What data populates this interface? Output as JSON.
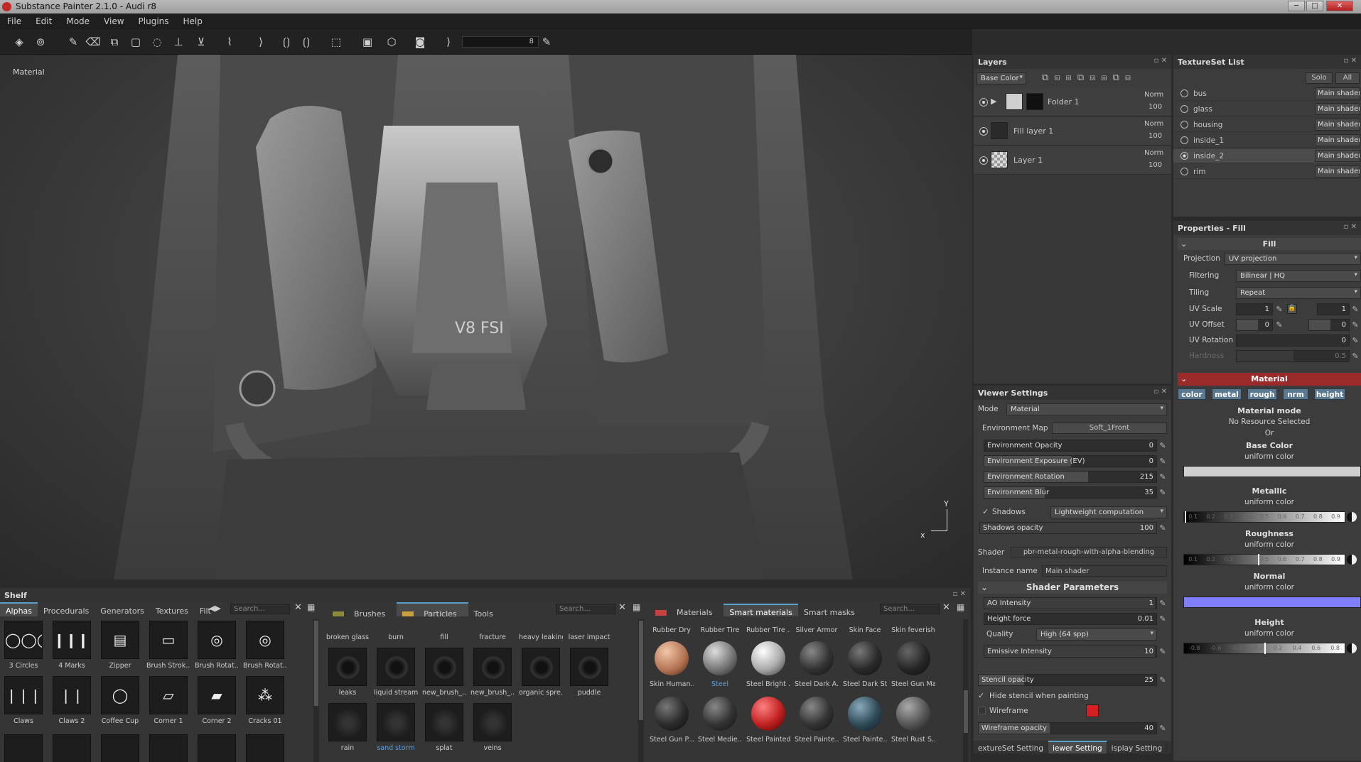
{
  "window": {
    "title": "Substance Painter 2.1.0 - Audi r8",
    "minimize": "─",
    "maximize": "□",
    "close": "✕"
  },
  "menu": [
    "File",
    "Edit",
    "Mode",
    "View",
    "Plugins",
    "Help"
  ],
  "toolbar": {
    "brush_size": "8",
    "icons": [
      "layers-icon",
      "substance-icon",
      "paint-brush-icon",
      "eraser-icon",
      "projection-icon",
      "polygon-fill-icon",
      "lasso-icon",
      "clone-icon",
      "stamp-icon",
      "smudge-icon",
      "picker-icon",
      "symmetry-icon",
      "camera-icon",
      "render-icon",
      "screenshot-icon"
    ]
  },
  "viewport": {
    "mode_label": "Material",
    "axis_x": "x",
    "axis_y": "Y",
    "engine_text": "V8 FSI"
  },
  "layers": {
    "title": "Layers",
    "channel": "Base Color",
    "items": [
      {
        "name": "Folder 1",
        "blend": "Norm",
        "opacity": "100"
      },
      {
        "name": "Fill layer 1",
        "blend": "Norm",
        "opacity": "100"
      },
      {
        "name": "Layer 1",
        "blend": "Norm",
        "opacity": "100"
      }
    ]
  },
  "textureset": {
    "title": "TextureSet List",
    "solo": "Solo",
    "all": "All",
    "items": [
      {
        "name": "bus",
        "shader": "Main shader"
      },
      {
        "name": "glass",
        "shader": "Main shader"
      },
      {
        "name": "housing",
        "shader": "Main shader"
      },
      {
        "name": "inside_1",
        "shader": "Main shader"
      },
      {
        "name": "inside_2",
        "shader": "Main shader"
      },
      {
        "name": "rim",
        "shader": "Main shader"
      }
    ]
  },
  "properties": {
    "title": "Properties - Fill",
    "fill_header": "Fill",
    "projection_label": "Projection",
    "projection_value": "UV projection",
    "filtering_label": "Filtering",
    "filtering_value": "Bilinear | HQ",
    "tiling_label": "Tiling",
    "tiling_value": "Repeat",
    "uv_scale_label": "UV Scale",
    "uv_scale_value": "1",
    "uv_scale_value2": "1",
    "uv_offset_label": "UV Offset",
    "uv_offset_value": "0",
    "uv_offset_value2": "0",
    "uv_rotation_label": "UV Rotation",
    "uv_rotation_value": "0",
    "hardness_label": "Hardness",
    "hardness_value": "0.5",
    "material_header": "Material",
    "channels": [
      "color",
      "metal",
      "rough",
      "nrm",
      "height"
    ],
    "material_mode_title": "Material mode",
    "material_mode_value": "No Resource Selected",
    "or_text": "Or",
    "base_color_title": "Base Color",
    "base_color_sub": "uniform color",
    "base_color_hex": "#cfcfcf",
    "metallic_title": "Metallic",
    "metallic_sub": "uniform color",
    "metallic_ticks": [
      "0.1",
      "0.2",
      "0.3",
      "0.4",
      "0.5",
      "0.6",
      "0.7",
      "0.8",
      "0.9"
    ],
    "roughness_title": "Roughness",
    "roughness_sub": "uniform color",
    "roughness_ticks": [
      "0.1",
      "0.2",
      "0.3",
      "0.4",
      "0.5",
      "0.6",
      "0.7",
      "0.8",
      "0.9"
    ],
    "normal_title": "Normal",
    "normal_sub": "uniform color",
    "normal_hex": "#7f7fff",
    "height_title": "Height",
    "height_sub": "uniform color",
    "height_ticks": [
      "-0.8",
      "-0.6",
      "-0.4",
      "-0.2",
      "0.2",
      "0.4",
      "0.6",
      "0.8"
    ]
  },
  "viewer": {
    "title": "Viewer Settings",
    "mode_label": "Mode",
    "mode_value": "Material",
    "env_map_label": "Environment Map",
    "env_map_value": "Soft_1Front",
    "env_opacity_label": "Environment Opacity",
    "env_opacity_value": "0",
    "env_exposure_label": "Environment Exposure (EV)",
    "env_exposure_value": "0",
    "env_rotation_label": "Environment Rotation",
    "env_rotation_value": "215",
    "env_blur_label": "Environment Blur",
    "env_blur_value": "35",
    "shadows_label": "Shadows",
    "shadows_value": "Lightweight computation",
    "shadows_opacity_label": "Shadows opacity",
    "shadows_opacity_value": "100",
    "shader_label": "Shader",
    "shader_value": "pbr-metal-rough-with-alpha-blending",
    "instance_label": "Instance name",
    "instance_value": "Main shader",
    "shader_params_header": "Shader Parameters",
    "ao_label": "AO Intensity",
    "ao_value": "1",
    "height_force_label": "Height force",
    "height_force_value": "0.01",
    "quality_label": "Quality",
    "quality_value": "High (64 spp)",
    "emissive_label": "Emissive Intensity",
    "emissive_value": "10",
    "stencil_label": "Stencil opacity",
    "stencil_value": "25",
    "hide_stencil_label": "Hide stencil when painting",
    "wireframe_label": "Wireframe",
    "wireframe_color": "#d42020",
    "wireframe_opacity_label": "Wireframe opacity",
    "wireframe_opacity_value": "40",
    "bottom_tabs": [
      "extureSet Setting",
      "iewer Setting",
      "isplay Setting"
    ]
  },
  "shelf": {
    "title": "Shelf",
    "tabs": [
      "Alphas",
      "Procedurals",
      "Generators",
      "Textures",
      "Filt"
    ],
    "search_placeholder": "Search...",
    "alphas": [
      "3 Circles",
      "4 Marks",
      "Zipper",
      "Brush Strok...",
      "Brush Rotat...",
      "Brush Rotat...",
      "Claws",
      "Claws 2",
      "Coffee Cup",
      "Corner 1",
      "Corner 2",
      "Cracks 01"
    ],
    "mid_tabs": [
      "Brushes",
      "Particles",
      "Tools"
    ],
    "particles_top": [
      "broken glass",
      "burn",
      "fill",
      "fracture",
      "heavy leaking",
      "laser impact"
    ],
    "particles_mid": [
      "leaks",
      "liquid stream",
      "new_brush_...",
      "new_brush_...",
      "organic spre...",
      "puddle"
    ],
    "particles_bottom": [
      "rain",
      "sand storm",
      "splat",
      "veins"
    ],
    "mat_tabs": [
      "Materials",
      "Smart materials",
      "Smart masks"
    ],
    "materials_top": [
      "Rubber Dry",
      "Rubber Tire",
      "Rubber Tire ...",
      "Silver Armor",
      "Skin Face",
      "Skin feverish"
    ],
    "materials_mid": [
      "Skin Human...",
      "Steel",
      "Steel Bright ...",
      "Steel Dark A...",
      "Steel Dark St...",
      "Steel Gun Mat"
    ],
    "materials_bottom": [
      "Steel Gun P...",
      "Steel Medie...",
      "Steel Painted",
      "Steel Painte...",
      "Steel Painte...",
      "Steel Rust S..."
    ]
  }
}
